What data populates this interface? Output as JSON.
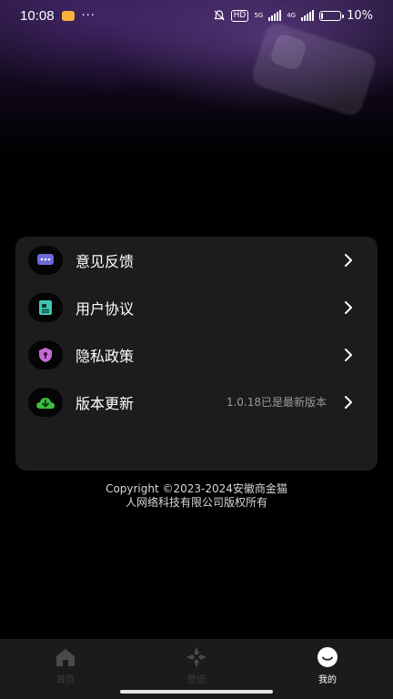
{
  "status_bar": {
    "time": "10:08",
    "more": "···",
    "hd_badge": "HD",
    "net_5g": "5G",
    "net_4g": "4G",
    "battery_text": "10%",
    "battery_level": 0.1
  },
  "menu": {
    "items": [
      {
        "label": "意见反馈",
        "detail": "",
        "icon": "feedback-chat-icon",
        "icon_color": "#6a6ad8"
      },
      {
        "label": "用户协议",
        "detail": "",
        "icon": "agreement-document-icon",
        "icon_color": "#3cc9b0"
      },
      {
        "label": "隐私政策",
        "detail": "",
        "icon": "privacy-shield-icon",
        "icon_color": "#c56ad8"
      },
      {
        "label": "版本更新",
        "detail": "1.0.18已是最新版本",
        "icon": "cloud-download-icon",
        "icon_color": "#3fbf3f"
      }
    ],
    "chevron_icon": "chevron-right-icon"
  },
  "copyright": {
    "line1": "Copyright ©2023-2024安徽商金猫",
    "line2": "人网络科技有限公司版权所有"
  },
  "bottom_nav": {
    "items": [
      {
        "label": "首页",
        "icon": "home-icon",
        "active": false
      },
      {
        "label": "壁纸",
        "icon": "wallpaper-icon",
        "active": false
      },
      {
        "label": "我的",
        "icon": "profile-smile-icon",
        "active": true
      }
    ]
  }
}
